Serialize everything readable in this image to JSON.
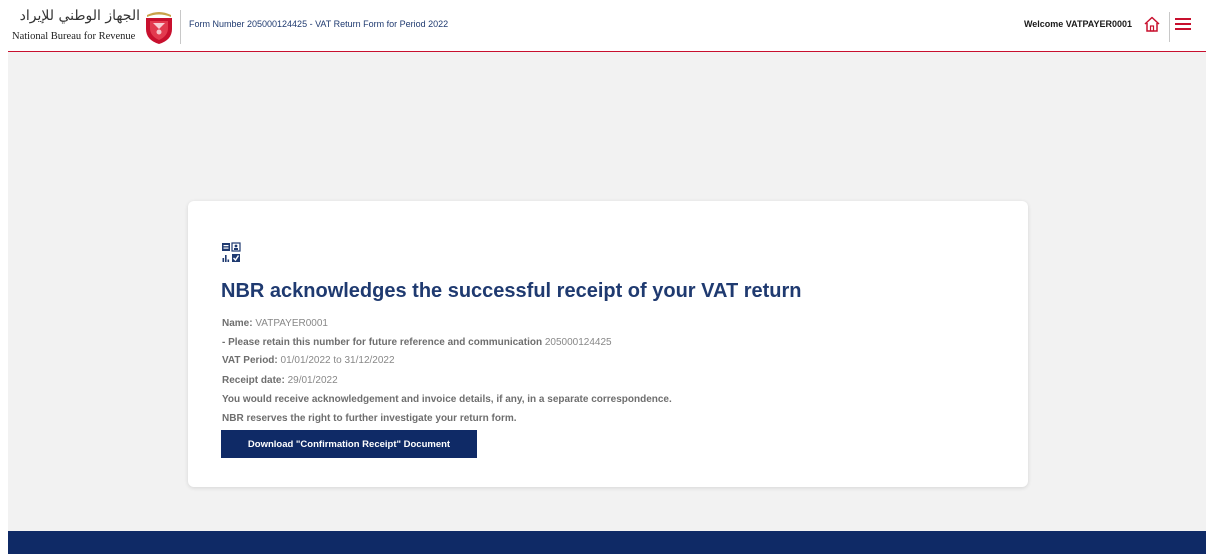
{
  "header": {
    "logo_arabic": "الجهاز الوطني للإيرادات",
    "logo_english": "National Bureau for Revenue",
    "form_title": "Form Number 205000124425 - VAT Return Form for Period 2022",
    "welcome": "Welcome VATPAYER0001",
    "home_icon": "home-icon",
    "menu_icon": "hamburger-menu-icon"
  },
  "card": {
    "icon": "acknowledgement-icon",
    "heading": "NBR acknowledges the successful receipt of your VAT return",
    "name_label": "Name:",
    "name_value": "VATPAYER0001",
    "reference_label": "- Please retain this number for future reference and communication",
    "reference_value": "205000124425",
    "vat_period_label": "VAT Period:",
    "vat_period_value": "01/01/2022 to 31/12/2022",
    "receipt_date_label": "Receipt date:",
    "receipt_date_value": "29/01/2022",
    "note_1": "You would receive acknowledgement and invoice details, if any, in a separate correspondence.",
    "note_2": "NBR reserves the right to further investigate your return form.",
    "download_button": "Download \"Confirmation Receipt\" Document"
  },
  "colors": {
    "primary": "#0f2a66",
    "accent": "#c8102e",
    "background": "#f2f2f2"
  }
}
